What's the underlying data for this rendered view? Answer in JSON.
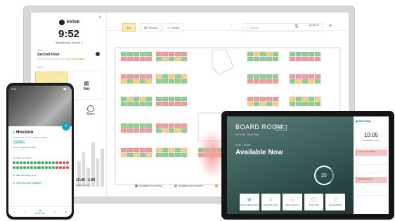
{
  "kiosk": {
    "brand": "KIOSK",
    "time": "9:52",
    "date": "Wednesday, August 1",
    "section_floor": "Floor",
    "floor_name": "Second Floor",
    "note_prefix": "This floor is connected to the building",
    "note_link": "Fourth Floor",
    "section_view": "View",
    "tiles": [
      {
        "label": "",
        "glyph": "▭"
      },
      {
        "label": "ne",
        "glyph": "≡"
      },
      {
        "label": "Grid",
        "glyph": "⊞"
      }
    ],
    "more": {
      "label": "More",
      "glyph": "..."
    },
    "room_time": "12:00 - 1:00",
    "room_name": "Board Room"
  },
  "toolbar": {
    "filters": [
      {
        "label": "ALL",
        "active": true
      },
      {
        "label": "Rooms",
        "active": false
      },
      {
        "label": "Desks",
        "active": false
      }
    ],
    "search_placeholder": "Search",
    "language": "EN"
  },
  "legend": [
    {
      "label": "Available for booking",
      "color": "#4caf50"
    },
    {
      "label": "Available not occupied",
      "color": "#8bc34a"
    },
    {
      "label": "",
      "color": "#f0a020"
    }
  ],
  "phone": {
    "status_time": "9:41",
    "status_icons": "▮▮ ◔",
    "location": "Houston",
    "meta": [
      "In-Nov 2024 · Desk · 4 Attend · Office",
      "Ad Hoc: Available All Day"
    ],
    "chip": "Available",
    "schedule_label": "Available Availability",
    "links": [
      "Add meeting room",
      "View planned meetings"
    ],
    "nav": [
      {
        "label": "",
        "icon": "▢"
      },
      {
        "label": "",
        "icon": "⌂"
      },
      {
        "label": "Book Map",
        "icon": "▦",
        "active": true
      },
      {
        "label": "",
        "icon": "☰"
      },
      {
        "label": "",
        "icon": "●"
      }
    ]
  },
  "tablet": {
    "room_title": "BOARD ROOM",
    "badge": "Meeting",
    "subtitle": "Up to 8 · 2nd Floor",
    "time_range": "9:00 - 10:00",
    "status": "Available Now",
    "ring_value": "25",
    "buttons": [
      {
        "label": "Add new Reservation",
        "icon": "⊕"
      },
      {
        "label": "Find other rooms",
        "icon": "⌕"
      },
      {
        "label": "Room Features",
        "icon": "☆"
      },
      {
        "label": "Room Info",
        "icon": "ⓘ"
      },
      {
        "label": "Give Feedback",
        "icon": "☺"
      }
    ],
    "brand": "SPACEIQ",
    "clock": "10:05",
    "clock_date": "Wednesday, July 1",
    "events": [
      {
        "title": "Product Roundtable",
        "time": "9:00 - 10:00"
      },
      {
        "title": "Strategy Meeting",
        "time": "12:00 - 1:00"
      }
    ]
  }
}
